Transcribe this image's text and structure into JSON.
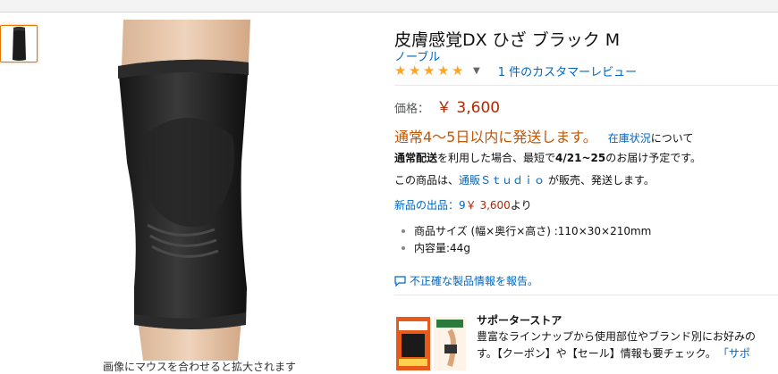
{
  "product": {
    "title": "皮膚感覚DX ひざ ブラック M",
    "brand": "ノーブル",
    "rating_stars": 5,
    "review_count_text": "1 件のカスタマーレビュー",
    "price_label": "価格：",
    "price": "￥ 3,600",
    "availability": "通常4～5日以内に発送します。",
    "stock_link": "在庫状況",
    "stock_suffix": "について",
    "delivery_bold": "通常配送",
    "delivery_mid": "を利用した場合、最短で",
    "delivery_date": "4/21~25",
    "delivery_tail": "のお届け予定です。",
    "seller_prefix": "この商品は、",
    "seller_name": "通販Ｓｔｕｄｉｏ",
    "seller_suffix": "が販売、発送します。",
    "new_offers_label": "新品の出品：9",
    "new_offers_price": "￥ 3,600",
    "new_offers_suffix": "より",
    "bullets": [
      "商品サイズ (幅×奥行×高さ) :110×30×210mm",
      "内容量:44g"
    ],
    "report_link": "不正確な製品情報を報告。",
    "image_caption": "画像にマウスを合わせると拡大されます"
  },
  "store": {
    "title": "サポーターストア",
    "desc_line1": "豊富なラインナップから使用部位やブランド別にお好みの",
    "desc_line2_a": "す。【クーポン】や【セール】情報も要チェック。",
    "desc_line2_link": "「サポ"
  },
  "colors": {
    "link": "#0066c0",
    "price": "#b12704",
    "availability": "#c45500",
    "star": "#ffa41c"
  }
}
